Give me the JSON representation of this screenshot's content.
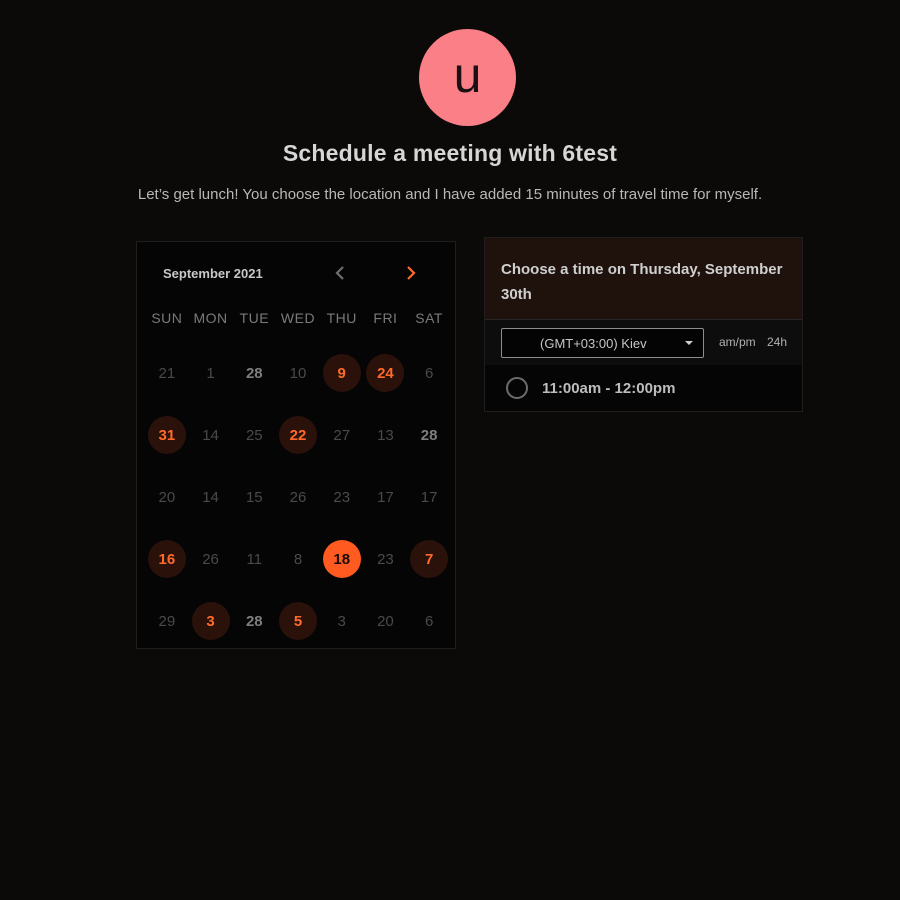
{
  "header": {
    "avatar_letter": "u",
    "title": "Schedule a meeting with 6test",
    "description": "Let’s get lunch! You choose the location and I have added 15 minutes of travel time for myself."
  },
  "calendar": {
    "month_label": "September 2021",
    "prev_icon": "chevron-left-icon",
    "next_icon": "chevron-right-icon",
    "weekdays": [
      "SUN",
      "MON",
      "TUE",
      "WED",
      "THU",
      "FRI",
      "SAT"
    ],
    "days": [
      {
        "label": "21",
        "state": "dim"
      },
      {
        "label": "1",
        "state": "dim"
      },
      {
        "label": "28",
        "state": "mid"
      },
      {
        "label": "10",
        "state": "dim"
      },
      {
        "label": "9",
        "state": "avail"
      },
      {
        "label": "24",
        "state": "avail"
      },
      {
        "label": "6",
        "state": "dim"
      },
      {
        "label": "31",
        "state": "avail"
      },
      {
        "label": "14",
        "state": "dim"
      },
      {
        "label": "25",
        "state": "dim"
      },
      {
        "label": "22",
        "state": "avail"
      },
      {
        "label": "27",
        "state": "dim"
      },
      {
        "label": "13",
        "state": "dim"
      },
      {
        "label": "28",
        "state": "mid"
      },
      {
        "label": "20",
        "state": "dim"
      },
      {
        "label": "14",
        "state": "dim"
      },
      {
        "label": "15",
        "state": "dim"
      },
      {
        "label": "26",
        "state": "dim"
      },
      {
        "label": "23",
        "state": "dim"
      },
      {
        "label": "17",
        "state": "dim"
      },
      {
        "label": "17",
        "state": "dim"
      },
      {
        "label": "16",
        "state": "avail"
      },
      {
        "label": "26",
        "state": "dim"
      },
      {
        "label": "11",
        "state": "dim"
      },
      {
        "label": "8",
        "state": "dim"
      },
      {
        "label": "18",
        "state": "sel"
      },
      {
        "label": "23",
        "state": "dim"
      },
      {
        "label": "7",
        "state": "avail"
      },
      {
        "label": "29",
        "state": "dim"
      },
      {
        "label": "3",
        "state": "avail"
      },
      {
        "label": "28",
        "state": "mid"
      },
      {
        "label": "5",
        "state": "avail"
      },
      {
        "label": "3",
        "state": "dim"
      },
      {
        "label": "20",
        "state": "dim"
      },
      {
        "label": "6",
        "state": "dim"
      }
    ]
  },
  "times_panel": {
    "heading": "Choose a time on Thursday, September 30th",
    "timezone_value": "(GMT+03:00) Kiev",
    "format_ampm": "am/pm",
    "format_24h": "24h",
    "slots": [
      {
        "label": "11:00am - 12:00pm"
      }
    ]
  },
  "colors": {
    "accent": "#ff5a1f",
    "avatar_bg": "#fb7f87",
    "background": "#0c0a08"
  }
}
